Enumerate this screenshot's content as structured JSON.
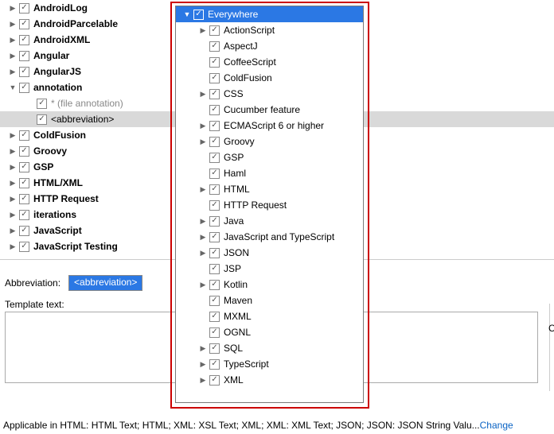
{
  "leftTree": [
    {
      "indent": 0,
      "toggle": "right",
      "checked": true,
      "label": "AndroidLog",
      "bold": true
    },
    {
      "indent": 0,
      "toggle": "right",
      "checked": true,
      "label": "AndroidParcelable",
      "bold": true
    },
    {
      "indent": 0,
      "toggle": "right",
      "checked": true,
      "label": "AndroidXML",
      "bold": true
    },
    {
      "indent": 0,
      "toggle": "right",
      "checked": true,
      "label": "Angular",
      "bold": true
    },
    {
      "indent": 0,
      "toggle": "right",
      "checked": true,
      "label": "AngularJS",
      "bold": true
    },
    {
      "indent": 0,
      "toggle": "down",
      "checked": true,
      "label": "annotation",
      "bold": true
    },
    {
      "indent": 1,
      "toggle": "",
      "checked": true,
      "label": "* (file annotation)",
      "bold": false,
      "muted": true
    },
    {
      "indent": 1,
      "toggle": "",
      "checked": true,
      "label": "<abbreviation>",
      "bold": false,
      "selected": true
    },
    {
      "indent": 0,
      "toggle": "right",
      "checked": true,
      "label": "ColdFusion",
      "bold": true
    },
    {
      "indent": 0,
      "toggle": "right",
      "checked": true,
      "label": "Groovy",
      "bold": true
    },
    {
      "indent": 0,
      "toggle": "right",
      "checked": true,
      "label": "GSP",
      "bold": true
    },
    {
      "indent": 0,
      "toggle": "right",
      "checked": true,
      "label": "HTML/XML",
      "bold": true
    },
    {
      "indent": 0,
      "toggle": "right",
      "checked": true,
      "label": "HTTP Request",
      "bold": true
    },
    {
      "indent": 0,
      "toggle": "right",
      "checked": true,
      "label": "iterations",
      "bold": true
    },
    {
      "indent": 0,
      "toggle": "right",
      "checked": true,
      "label": "JavaScript",
      "bold": true
    },
    {
      "indent": 0,
      "toggle": "right",
      "checked": true,
      "label": "JavaScript Testing",
      "bold": true
    }
  ],
  "popupHeader": {
    "toggle": "down",
    "checked": true,
    "label": "Everywhere"
  },
  "popupItems": [
    {
      "toggle": "right",
      "label": "ActionScript"
    },
    {
      "toggle": "",
      "label": "AspectJ"
    },
    {
      "toggle": "",
      "label": "CoffeeScript"
    },
    {
      "toggle": "",
      "label": "ColdFusion"
    },
    {
      "toggle": "right",
      "label": "CSS"
    },
    {
      "toggle": "",
      "label": "Cucumber feature"
    },
    {
      "toggle": "right",
      "label": "ECMAScript 6 or higher"
    },
    {
      "toggle": "right",
      "label": "Groovy"
    },
    {
      "toggle": "",
      "label": "GSP"
    },
    {
      "toggle": "",
      "label": "Haml"
    },
    {
      "toggle": "right",
      "label": "HTML"
    },
    {
      "toggle": "",
      "label": "HTTP Request"
    },
    {
      "toggle": "right",
      "label": "Java"
    },
    {
      "toggle": "right",
      "label": "JavaScript and TypeScript"
    },
    {
      "toggle": "right",
      "label": "JSON"
    },
    {
      "toggle": "",
      "label": "JSP"
    },
    {
      "toggle": "right",
      "label": "Kotlin"
    },
    {
      "toggle": "",
      "label": "Maven"
    },
    {
      "toggle": "",
      "label": "MXML"
    },
    {
      "toggle": "",
      "label": "OGNL"
    },
    {
      "toggle": "right",
      "label": "SQL"
    },
    {
      "toggle": "right",
      "label": "TypeScript"
    },
    {
      "toggle": "right",
      "label": "XML"
    }
  ],
  "form": {
    "abbreviation_label": "Abbreviation:",
    "abbreviation_value": "<abbreviation>",
    "template_text_label": "Template text:"
  },
  "applicable": {
    "prefix": "Applicable in HTML: HTML Text; HTML; XML: XSL Text; XML; XML: XML Text; JSON; JSON: JSON String Valu...",
    "link": "Change"
  },
  "sideChar": "C"
}
